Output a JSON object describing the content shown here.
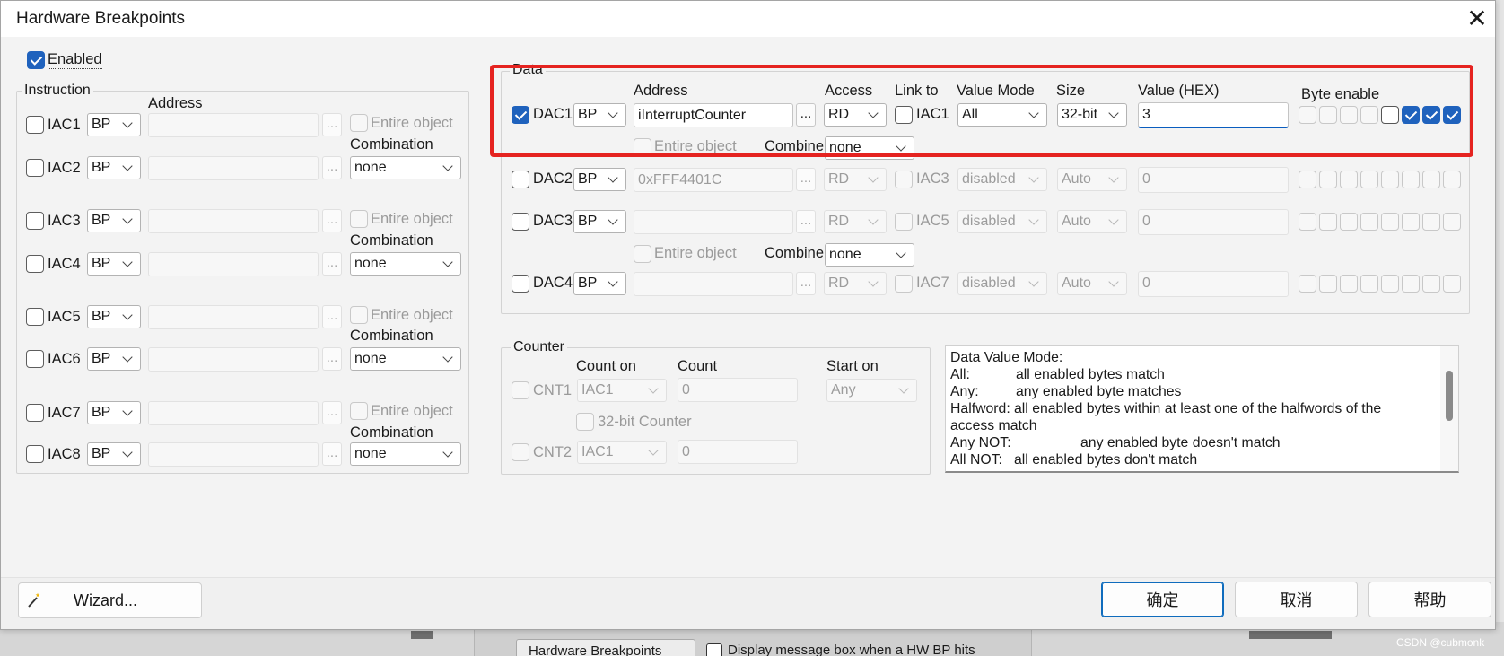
{
  "dialog": {
    "title": "Hardware Breakpoints"
  },
  "enabled_label": "Enabled",
  "instruction": {
    "group_label": "Instruction",
    "address_header": "Address",
    "rows": [
      {
        "label": "IAC1",
        "type": "BP"
      },
      {
        "label": "IAC2",
        "type": "BP"
      },
      {
        "label": "IAC3",
        "type": "BP"
      },
      {
        "label": "IAC4",
        "type": "BP"
      },
      {
        "label": "IAC5",
        "type": "BP"
      },
      {
        "label": "IAC6",
        "type": "BP"
      },
      {
        "label": "IAC7",
        "type": "BP"
      },
      {
        "label": "IAC8",
        "type": "BP"
      }
    ],
    "pairs": [
      {
        "entire_object": "Entire object",
        "combination_label": "Combination",
        "combination": "none"
      },
      {
        "entire_object": "Entire object",
        "combination_label": "Combination",
        "combination": "none"
      },
      {
        "entire_object": "Entire object",
        "combination_label": "Combination",
        "combination": "none"
      },
      {
        "entire_object": "Entire object",
        "combination_label": "Combination",
        "combination": "none"
      }
    ],
    "dots": "..."
  },
  "data": {
    "group_label": "Data",
    "headers": {
      "address": "Address",
      "access": "Access",
      "link_to": "Link to",
      "value_mode": "Value Mode",
      "size": "Size",
      "value_hex": "Value (HEX)",
      "byte_enable": "Byte enable"
    },
    "rows": [
      {
        "label": "DAC1",
        "checked": true,
        "type": "BP",
        "address": "iInterruptCounter",
        "access": "RD",
        "link": "IAC1",
        "value_mode": "All",
        "size": "32-bit",
        "value": "3",
        "bytes": [
          0,
          0,
          0,
          0,
          1,
          2,
          2,
          2
        ]
      },
      {
        "label": "DAC2",
        "checked": false,
        "type": "BP",
        "address": "0xFFF4401C",
        "access": "RD",
        "link": "IAC3",
        "value_mode": "disabled",
        "size": "Auto",
        "value": "0",
        "bytes": [
          0,
          0,
          0,
          0,
          0,
          0,
          0,
          0
        ]
      },
      {
        "label": "DAC3",
        "checked": false,
        "type": "BP",
        "address": "",
        "access": "RD",
        "link": "IAC5",
        "value_mode": "disabled",
        "size": "Auto",
        "value": "0",
        "bytes": [
          0,
          0,
          0,
          0,
          0,
          0,
          0,
          0
        ]
      },
      {
        "label": "DAC4",
        "checked": false,
        "type": "BP",
        "address": "",
        "access": "RD",
        "link": "IAC7",
        "value_mode": "disabled",
        "size": "Auto",
        "value": "0",
        "bytes": [
          0,
          0,
          0,
          0,
          0,
          0,
          0,
          0
        ]
      }
    ],
    "combine_rows": [
      {
        "entire_object": "Entire object",
        "combine_label": "Combine",
        "combine": "none"
      },
      {
        "entire_object": "Entire object",
        "combine_label": "Combine",
        "combine": "none"
      }
    ],
    "dots": "..."
  },
  "counter": {
    "group_label": "Counter",
    "count_on_header": "Count on",
    "count_header": "Count",
    "start_on_header": "Start on",
    "start_on": "Any",
    "cnt1": {
      "label": "CNT1",
      "count_on": "IAC1",
      "count": "0"
    },
    "counter32_label": "32-bit Counter",
    "cnt2": {
      "label": "CNT2",
      "count_on": "IAC1",
      "count": "0"
    }
  },
  "info": {
    "title": "Data Value Mode:",
    "all_key": "All:",
    "all_desc": "all enabled bytes match",
    "any_key": "Any:",
    "any_desc": "any enabled byte matches",
    "half_key": "Halfword:",
    "half_desc": "all enabled bytes within at least one of the halfwords of the",
    "half_desc2": "access match",
    "anynot_key": "Any NOT:",
    "anynot_desc": "any enabled byte doesn't match",
    "allnot_key": "All NOT:",
    "allnot_desc": "all enabled bytes don't match"
  },
  "buttons": {
    "wizard": "Wizard...",
    "ok": "确定",
    "cancel": "取消",
    "help": "帮助"
  },
  "background": {
    "tab": "Hardware Breakpoints",
    "checkbox_label": "Display message box when a HW BP hits",
    "watermark": "CSDN @cubmonk"
  }
}
